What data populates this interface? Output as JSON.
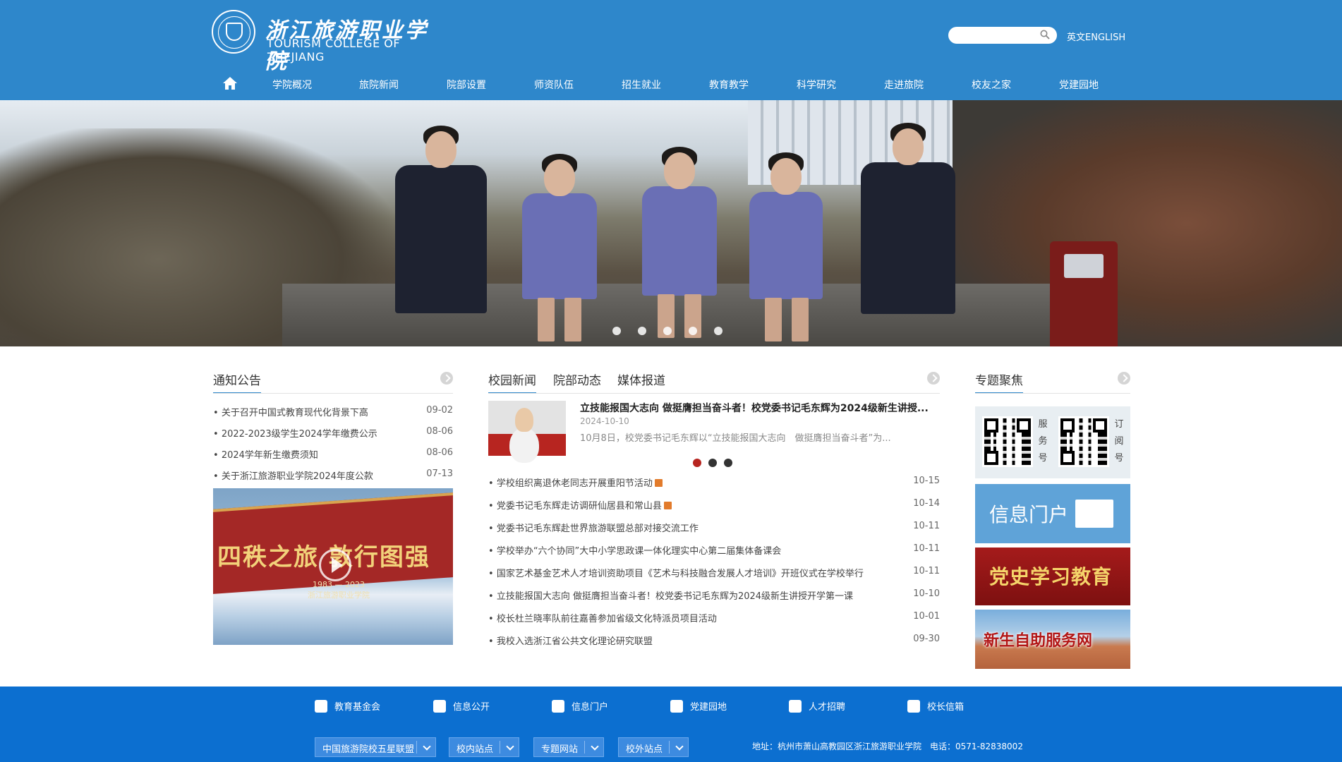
{
  "header": {
    "logo_cn": "浙江旅游职业学院",
    "logo_en": "TOURISM COLLEGE OF ZHEJIANG",
    "search_placeholder": "",
    "lang_link": "英文ENGLISH"
  },
  "nav": {
    "items": [
      "学院概况",
      "旅院新闻",
      "院部设置",
      "师资队伍",
      "招生就业",
      "教育教学",
      "科学研究",
      "走进旅院",
      "校友之家",
      "党建园地"
    ]
  },
  "banner": {
    "slides": 5,
    "active": 0
  },
  "notices": {
    "title": "通知公告",
    "items": [
      {
        "title": "关于召开中国式教育现代化背景下高",
        "date": "09-02"
      },
      {
        "title": "2022-2023级学生2024学年缴费公示",
        "date": "08-06"
      },
      {
        "title": "2024学年新生缴费须知",
        "date": "08-06"
      },
      {
        "title": "关于浙江旅游职业学院2024年度公款",
        "date": "07-13"
      }
    ],
    "video_title": "四秩之旅 敦行图强",
    "video_sub": "1983 — 2023",
    "video_org": "浙江旅游职业学院"
  },
  "news": {
    "tabs": [
      "校园新闻",
      "院部动态",
      "媒体报道"
    ],
    "featured": {
      "title": "立技能报国大志向 做挺膺担当奋斗者！校党委书记毛东辉为2024级新生讲授...",
      "date": "2024-10-10",
      "summary": "10月8日，校党委书记毛东辉以“立技能报国大志向　做挺膺担当奋斗者”为..."
    },
    "items": [
      {
        "title": "学校组织离退休老同志开展重阳节活动",
        "date": "10-15",
        "new": true
      },
      {
        "title": "党委书记毛东辉走访调研仙居县和常山县",
        "date": "10-14",
        "new": true
      },
      {
        "title": "党委书记毛东辉赴世界旅游联盟总部对接交流工作",
        "date": "10-11",
        "new": false
      },
      {
        "title": "学校举办“六个协同”大中小学思政课一体化理实中心第二届集体备课会",
        "date": "10-11",
        "new": false
      },
      {
        "title": "国家艺术基金艺术人才培训资助项目《艺术与科技融合发展人才培训》开班仪式在学校举行",
        "date": "10-11",
        "new": false
      },
      {
        "title": "立技能报国大志向 做挺膺担当奋斗者！校党委书记毛东辉为2024级新生讲授开学第一课",
        "date": "10-10",
        "new": false
      },
      {
        "title": "校长杜兰晓率队前往嘉善参加省级文化特派员项目活动",
        "date": "10-01",
        "new": false
      },
      {
        "title": "我校入选浙江省公共文化理论研究联盟",
        "date": "09-30",
        "new": false
      }
    ]
  },
  "topics": {
    "title": "专题聚焦",
    "qr1_label": [
      "服",
      "务",
      "号"
    ],
    "qr2_label": [
      "订",
      "阅",
      "号"
    ],
    "portal": "信息门户",
    "party": "党史学习教育",
    "freshmen": "新生自助服务网"
  },
  "footer": {
    "links": [
      "教育基金会",
      "信息公开",
      "信息门户",
      "党建园地",
      "人才招聘",
      "校长信箱"
    ],
    "selects": [
      "中国旅游院校五星联盟",
      "校内站点",
      "专题网站",
      "校外站点"
    ],
    "address": "地址：杭州市萧山高教园区浙江旅游职业学院　电话：0571-82838002"
  },
  "colors": {
    "primary": "#2e87cb",
    "footer": "#0c6fd0",
    "accent_red": "#b72520"
  }
}
